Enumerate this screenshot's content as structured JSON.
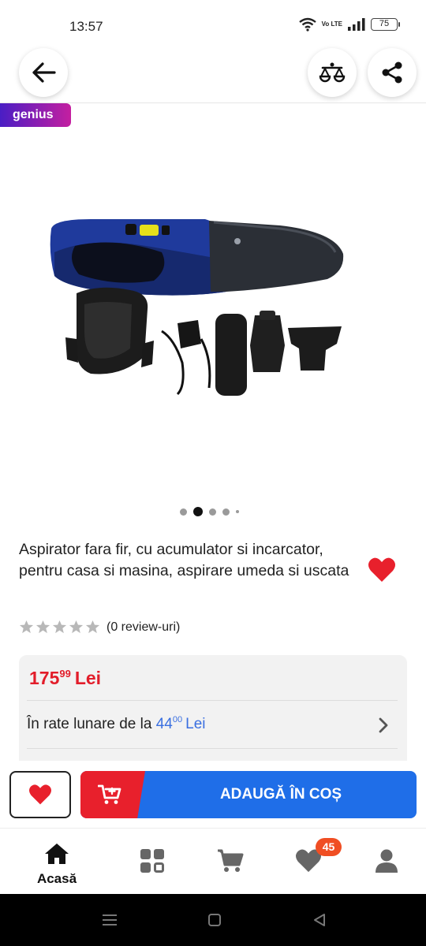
{
  "status_bar": {
    "time": "13:57",
    "network_label": "Vo LTE",
    "battery_level": "75",
    "icons": [
      "wifi-icon",
      "volte-icon",
      "signal-icon",
      "battery-icon"
    ]
  },
  "header": {
    "buttons": [
      "back-arrow-icon",
      "compare-scale-icon",
      "share-icon"
    ]
  },
  "badge": {
    "label": "genius"
  },
  "gallery": {
    "image_description_icon": "product-photo-handheld-vacuum",
    "image_count": 5,
    "active_index": 1
  },
  "product": {
    "title": "Aspirator fara fir, cu acumulator si incarcator, pentru casa si masina, aspirare umeda si uscata",
    "favorited": true,
    "rating_stars": 0,
    "max_stars": 5,
    "review_text": "(0 review-uri)"
  },
  "price": {
    "integer": "175",
    "decimals": "99",
    "currency": "Lei"
  },
  "installments": {
    "prefix": "În rate lunare de la",
    "integer": "44",
    "decimals": "00",
    "currency": "Lei"
  },
  "actions": {
    "add_to_cart_label": "ADAUGĂ ÎN COȘ"
  },
  "bottom_nav": {
    "home_label": "Acasă",
    "favorites_count": "45",
    "items": [
      "home-icon",
      "categories-icon",
      "cart-icon",
      "favorites-icon",
      "account-icon"
    ]
  },
  "colors": {
    "brand_red": "#e8202c",
    "brand_blue": "#1f6ee8",
    "price_red": "#e21d2a",
    "link_blue": "#3a6fe0",
    "badge_orange": "#f04e23",
    "genius_gradient": [
      "#4a1ec4",
      "#c41fa0"
    ]
  }
}
